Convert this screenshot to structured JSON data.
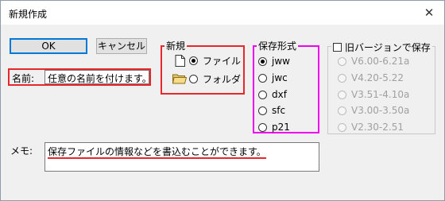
{
  "window": {
    "title": "新規作成",
    "close_symbol": "✕"
  },
  "buttons": {
    "ok": "OK",
    "cancel": "キャンセル"
  },
  "name": {
    "label": "名前:",
    "value": "任意の名前を付けます。"
  },
  "new_group": {
    "title": "新規",
    "options": [
      {
        "label": "ファイル",
        "selected": true,
        "icon": "file-icon"
      },
      {
        "label": "フォルダ",
        "selected": false,
        "icon": "folder-icon"
      }
    ]
  },
  "format_group": {
    "title": "保存形式",
    "options": [
      {
        "label": "jww",
        "selected": true
      },
      {
        "label": "jwc",
        "selected": false
      },
      {
        "label": "dxf",
        "selected": false
      },
      {
        "label": "sfc",
        "selected": false
      },
      {
        "label": "p21",
        "selected": false
      }
    ]
  },
  "old_version": {
    "checkbox_label": "旧バージョンで保存",
    "checked": false,
    "options": [
      {
        "label": "V6.00-6.21a"
      },
      {
        "label": "V4.20-5.22"
      },
      {
        "label": "V3.51-4.10a"
      },
      {
        "label": "V3.00-3.50a"
      },
      {
        "label": "V2.30-2.51"
      }
    ]
  },
  "memo": {
    "label": "メモ:",
    "value": "保存ファイルの情報などを書込むことができます。"
  },
  "colors": {
    "highlight_red": "#e8272d",
    "highlight_magenta": "#ee00ee",
    "accent": "#0078d7"
  }
}
